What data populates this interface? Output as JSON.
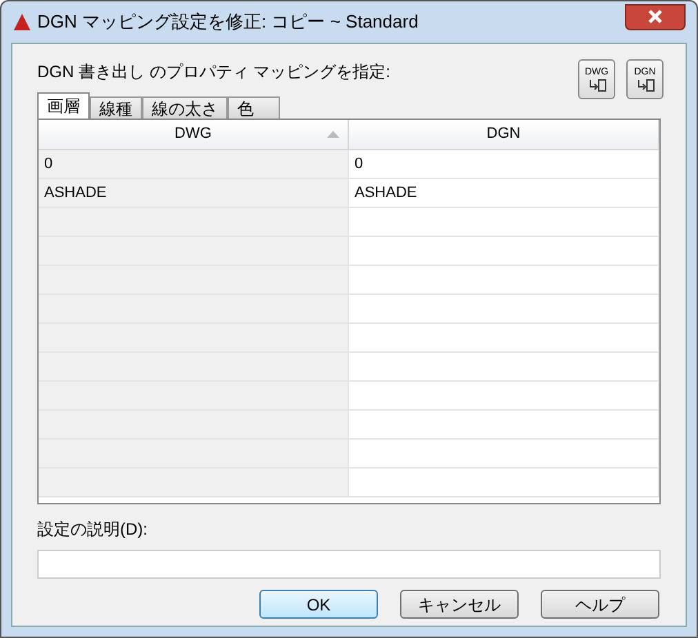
{
  "window": {
    "title": "DGN マッピング設定を修正:  コピー ~ Standard"
  },
  "heading": "DGN 書き出し のプロパティ マッピングを指定:",
  "tool_buttons": [
    {
      "label": "DWG"
    },
    {
      "label": "DGN"
    }
  ],
  "tabs": [
    {
      "label": "画層",
      "selected": true
    },
    {
      "label": "線種",
      "selected": false
    },
    {
      "label": "線の太さ",
      "selected": false
    },
    {
      "label": "色",
      "selected": false
    }
  ],
  "table": {
    "columns": [
      {
        "label": "DWG",
        "sorted": true
      },
      {
        "label": "DGN",
        "sorted": false
      }
    ],
    "rows": [
      [
        "0",
        "0"
      ],
      [
        "ASHADE",
        "ASHADE"
      ]
    ]
  },
  "description": {
    "label": "設定の説明(D):"
  },
  "buttons": [
    {
      "label": "OK",
      "default": true
    },
    {
      "label": "キャンセル",
      "default": false
    },
    {
      "label": "ヘルプ",
      "default": false
    }
  ]
}
